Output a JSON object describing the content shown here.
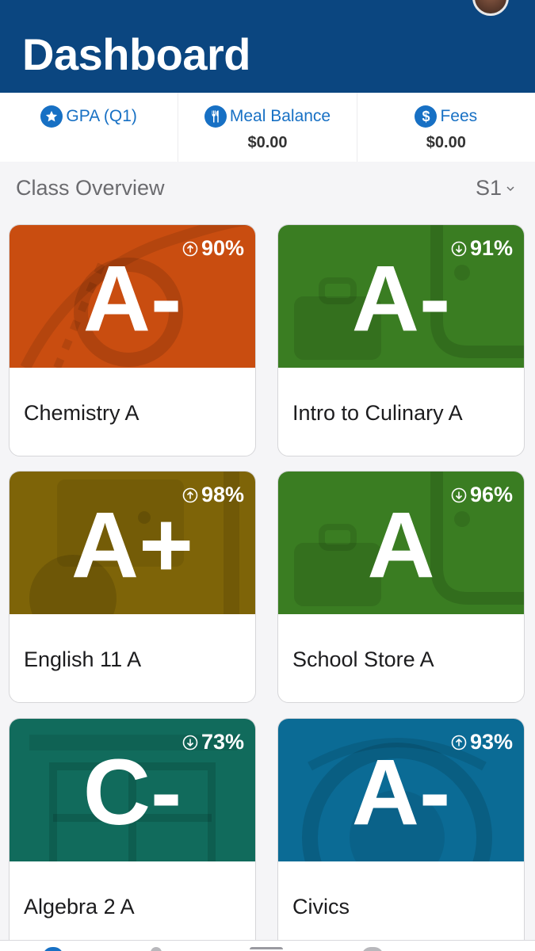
{
  "header": {
    "title": "Dashboard"
  },
  "summary": [
    {
      "label": "GPA (Q1)",
      "value": "",
      "icon": "star-icon"
    },
    {
      "label": "Meal Balance",
      "value": "$0.00",
      "icon": "utensils-icon"
    },
    {
      "label": "Fees",
      "value": "$0.00",
      "icon": "dollar-icon"
    }
  ],
  "section": {
    "title": "Class Overview",
    "term": "S1"
  },
  "classes": [
    {
      "name": "Chemistry A",
      "grade": "A-",
      "percent": "90%",
      "trend": "up",
      "color": "#c94d10"
    },
    {
      "name": "Intro to Culinary A",
      "grade": "A-",
      "percent": "91%",
      "trend": "down",
      "color": "#3a7d22"
    },
    {
      "name": "English 11 A",
      "grade": "A+",
      "percent": "98%",
      "trend": "up",
      "color": "#7e6408"
    },
    {
      "name": "School Store A",
      "grade": "A",
      "percent": "96%",
      "trend": "down",
      "color": "#3a7d22"
    },
    {
      "name": "Algebra 2 A",
      "grade": "C-",
      "percent": "73%",
      "trend": "down",
      "color": "#116b5c"
    },
    {
      "name": "Civics",
      "grade": "A-",
      "percent": "93%",
      "trend": "up",
      "color": "#0b6b95"
    }
  ],
  "colors": {
    "header": "#0b4680",
    "accent": "#1770c4"
  }
}
